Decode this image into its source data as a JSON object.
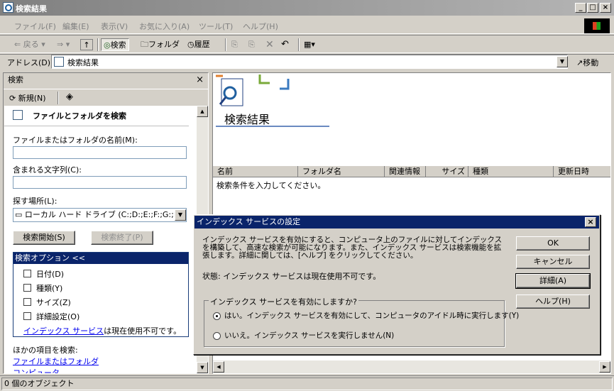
{
  "window": {
    "title": "検索結果",
    "minimize": "_",
    "maximize": "□",
    "close": "×"
  },
  "menu": [
    "ファイル(F)",
    "編集(E)",
    "表示(V)",
    "お気に入り(A)",
    "ツール(T)",
    "ヘルプ(H)"
  ],
  "toolbar": {
    "back": "戻る",
    "search": "検索",
    "folders": "フォルダ",
    "history": "履歴"
  },
  "address": {
    "label": "アドレス(D)",
    "value": "検索結果",
    "go": "移動"
  },
  "search_pane": {
    "title": "検索",
    "new_label": "新規(N)",
    "heading": "ファイルとフォルダを検索",
    "name_label": "ファイルまたはフォルダの名前(M):",
    "name_value": "",
    "text_label": "含まれる文字列(C):",
    "text_value": "",
    "location_label": "探す場所(L):",
    "location_value": "ローカル ハード ドライブ (C:;D:;E:;F:;G:;H:;L:M",
    "start_button": "検索開始(S)",
    "stop_button": "検索終了(P)",
    "options_header": "検索オプション <<",
    "options": [
      "日付(D)",
      "種類(Y)",
      "サイズ(Z)",
      "詳細設定(O)"
    ],
    "index_link": "インデックス サービス",
    "index_text": "は現在使用不可です。",
    "other_label": "ほかの項目を検索:",
    "other_links": [
      "ファイルまたはフォルダ",
      "コンピュータ"
    ]
  },
  "results": {
    "title": "検索結果",
    "columns": [
      "名前",
      "フォルダ名",
      "関連情報",
      "サイズ",
      "種類",
      "更新日時"
    ],
    "empty_text": "検索条件を入力してください。"
  },
  "dialog": {
    "title": "インデックス サービスの設定",
    "description": "インデックス サービスを有効にすると、コンピュータ上のファイルに対してインデックスを構築して、高速な検索が可能になります。また、インデックス サービスは検索機能を拡張します。詳細に関しては、[ヘルプ] をクリックしてください。",
    "status": "状態: インデックス サービスは現在使用不可です。",
    "group_label": "インデックス サービスを有効にしますか?",
    "option_yes": "はい。インデックス サービスを有効にして、コンピュータのアイドル時に実行します(Y)",
    "option_no": "いいえ。インデックス サービスを実行しません(N)",
    "selected": "yes",
    "ok": "OK",
    "cancel": "キャンセル",
    "details": "詳細(A)",
    "help": "ヘルプ(H)"
  },
  "statusbar": {
    "text": "0 個のオブジェクト"
  }
}
